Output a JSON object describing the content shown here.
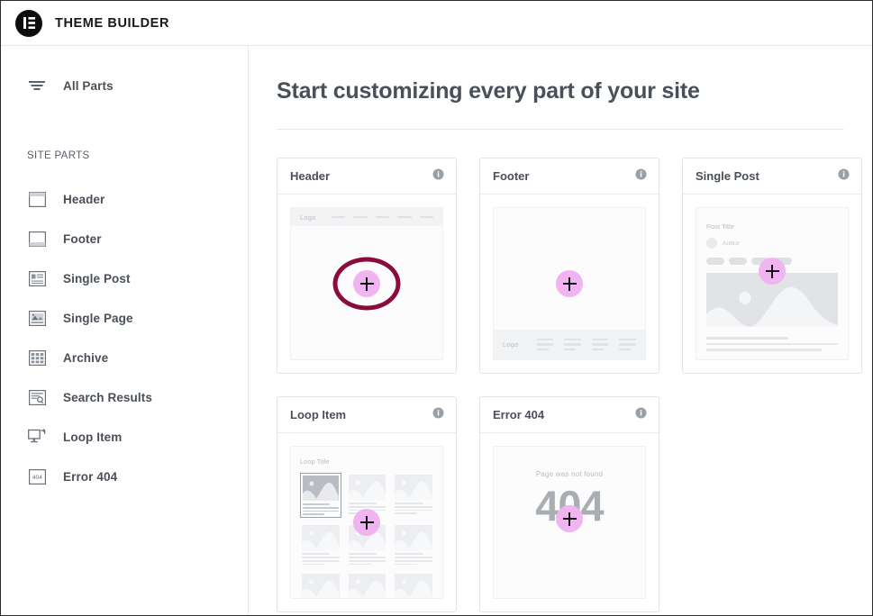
{
  "topbar": {
    "logo_icon": "elementor-logo-icon",
    "title": "THEME BUILDER"
  },
  "sidebar": {
    "all_parts": {
      "label": "All Parts",
      "icon": "filter-lines-icon"
    },
    "section_title": "SITE PARTS",
    "items": [
      {
        "label": "Header",
        "icon": "header-layout-icon"
      },
      {
        "label": "Footer",
        "icon": "footer-layout-icon"
      },
      {
        "label": "Single Post",
        "icon": "single-post-icon"
      },
      {
        "label": "Single Page",
        "icon": "single-page-icon"
      },
      {
        "label": "Archive",
        "icon": "archive-grid-icon"
      },
      {
        "label": "Search Results",
        "icon": "search-results-icon"
      },
      {
        "label": "Loop Item",
        "icon": "loop-item-icon"
      },
      {
        "label": "Error 404",
        "icon": "error-404-icon"
      }
    ]
  },
  "main": {
    "page_title": "Start customizing every part of your site",
    "cards": [
      {
        "name": "Header",
        "info_icon": "info-circle-icon",
        "add_button_label": "+",
        "annotated": true,
        "mock": {
          "logo_text": "Logo",
          "nav_items": 5
        }
      },
      {
        "name": "Footer",
        "info_icon": "info-circle-icon",
        "add_button_label": "+",
        "annotated": false,
        "mock": {
          "logo_text": "Logo",
          "columns": 4,
          "lines_per_column": 3
        }
      },
      {
        "name": "Single Post",
        "info_icon": "info-circle-icon",
        "add_button_label": "+",
        "annotated": false,
        "mock": {
          "post_title": "Post Title",
          "author": "Author",
          "pills": 4,
          "body_lines": 3
        }
      },
      {
        "name": "Loop Item",
        "info_icon": "info-circle-icon",
        "add_button_label": "+",
        "annotated": false,
        "mock": {
          "loop_title": "Loop Title",
          "grid_columns": 3,
          "grid_rows": 3,
          "active_cell": 0
        }
      },
      {
        "name": "Error 404",
        "info_icon": "info-circle-icon",
        "add_button_label": "+",
        "annotated": false,
        "mock": {
          "subtitle": "Page was not found",
          "code": "404"
        }
      }
    ]
  },
  "colors": {
    "accent_pink": "#F0B4F0",
    "annotation_maroon": "#8C0B3D",
    "text_slate": "#4A5059",
    "border_gray": "#E3E5E8",
    "placeholder_gray": "#DFE1E5"
  }
}
